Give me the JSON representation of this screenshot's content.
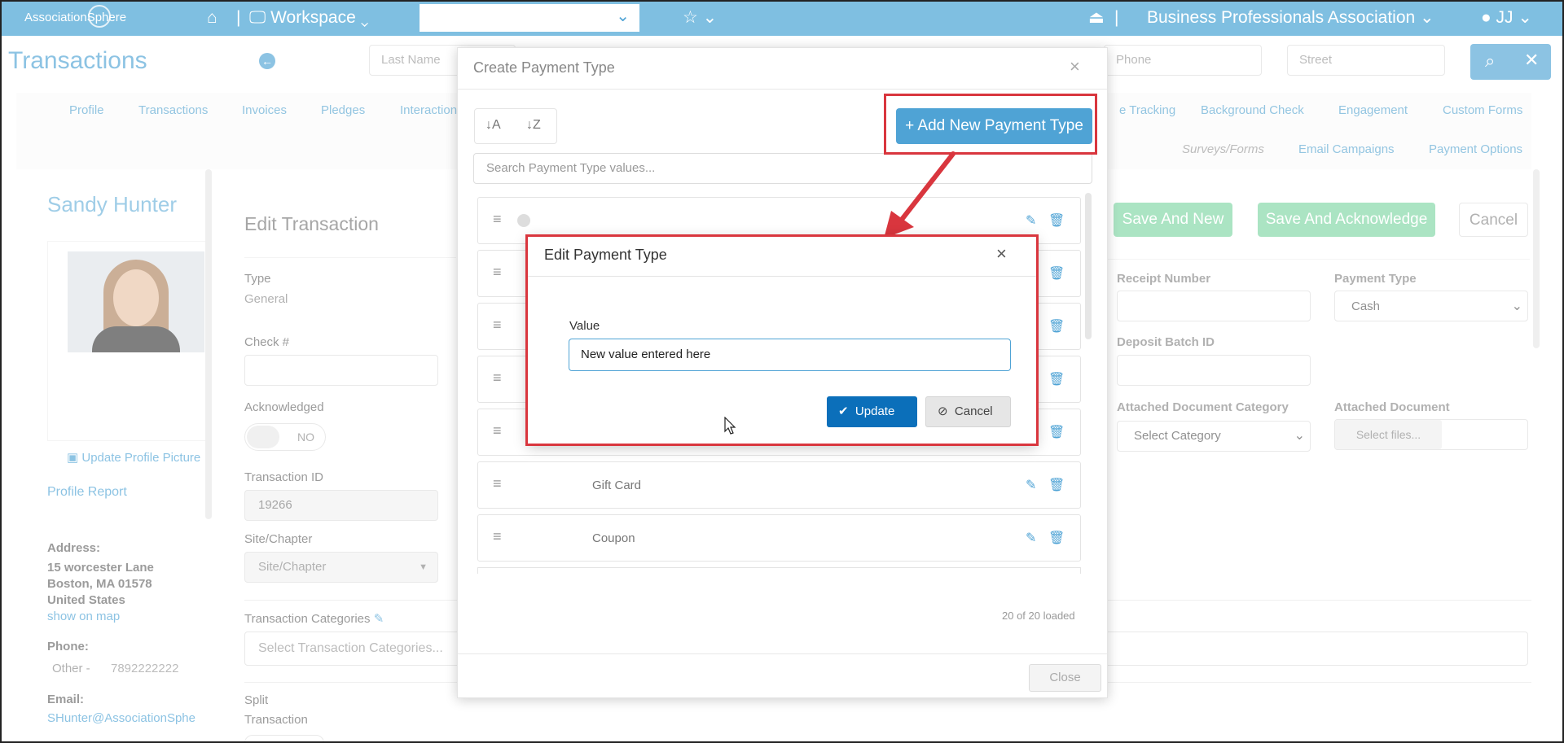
{
  "topbar": {
    "logo": "AssociationSphere",
    "workspace": "Workspace",
    "org": "Business Professionals Association",
    "user": "JJ",
    "sep": "|"
  },
  "page": {
    "title": "Transactions",
    "last_name_placeholder": "Last Name",
    "phone_placeholder": "Phone",
    "street_placeholder": "Street"
  },
  "tabs": {
    "row1": [
      "Profile",
      "Transactions",
      "Invoices",
      "Pledges",
      "Interaction"
    ],
    "row1_right": [
      "e Tracking",
      "Background Check",
      "Engagement",
      "Custom Forms"
    ],
    "row2": [
      "Surveys/Forms",
      "Email Campaigns",
      "Payment Options"
    ]
  },
  "profile": {
    "name": "Sandy Hunter",
    "update_pic": "Update Profile Picture",
    "report": "Profile Report",
    "address_label": "Address:",
    "address1": "15 worcester Lane",
    "address2": "Boston, MA 01578",
    "address3": "United States",
    "map": "show on map",
    "phone_label": "Phone:",
    "phone_type": "Other -",
    "phone": "7892222222",
    "email_label": "Email:",
    "email": "SHunter@AssociationSphe"
  },
  "edit": {
    "title": "Edit Transaction",
    "type_label": "Type",
    "type_value": "General",
    "check_label": "Check #",
    "ack_label": "Acknowledged",
    "ack_value": "NO",
    "tid_label": "Transaction ID",
    "tid_value": "19266",
    "site_label": "Site/Chapter",
    "site_value": "Site/Chapter",
    "cat_label": "Transaction Categories",
    "cat_placeholder": "Select Transaction Categories...",
    "split_label1": "Split",
    "split_label2": "Transaction"
  },
  "right": {
    "save_new": "Save And New",
    "save_ack": "Save And Acknowledge",
    "cancel": "Cancel",
    "receipt_label": "Receipt Number",
    "ptype_label": "Payment Type",
    "ptype_value": "Cash",
    "deposit_label": "Deposit Batch ID",
    "doc_cat_label": "Attached Document Category",
    "doc_cat_value": "Select Category",
    "doc_label": "Attached Document",
    "doc_btn": "Select files..."
  },
  "modal": {
    "title": "Create Payment Type",
    "close": "×",
    "add_button": "+ Add New Payment Type",
    "search_placeholder": "Search Payment Type values...",
    "items": [
      "Gift Card",
      "Coupon"
    ],
    "loaded": "20 of 20 loaded",
    "close_button": "Close"
  },
  "dialog": {
    "title": "Edit Payment Type",
    "close": "×",
    "value_label": "Value",
    "value": "New value entered here",
    "update": "Update",
    "cancel": "Cancel"
  },
  "colors": {
    "accent": "#4fa3d5",
    "highlight": "#d9363e",
    "primary_btn": "#0b6fba"
  }
}
